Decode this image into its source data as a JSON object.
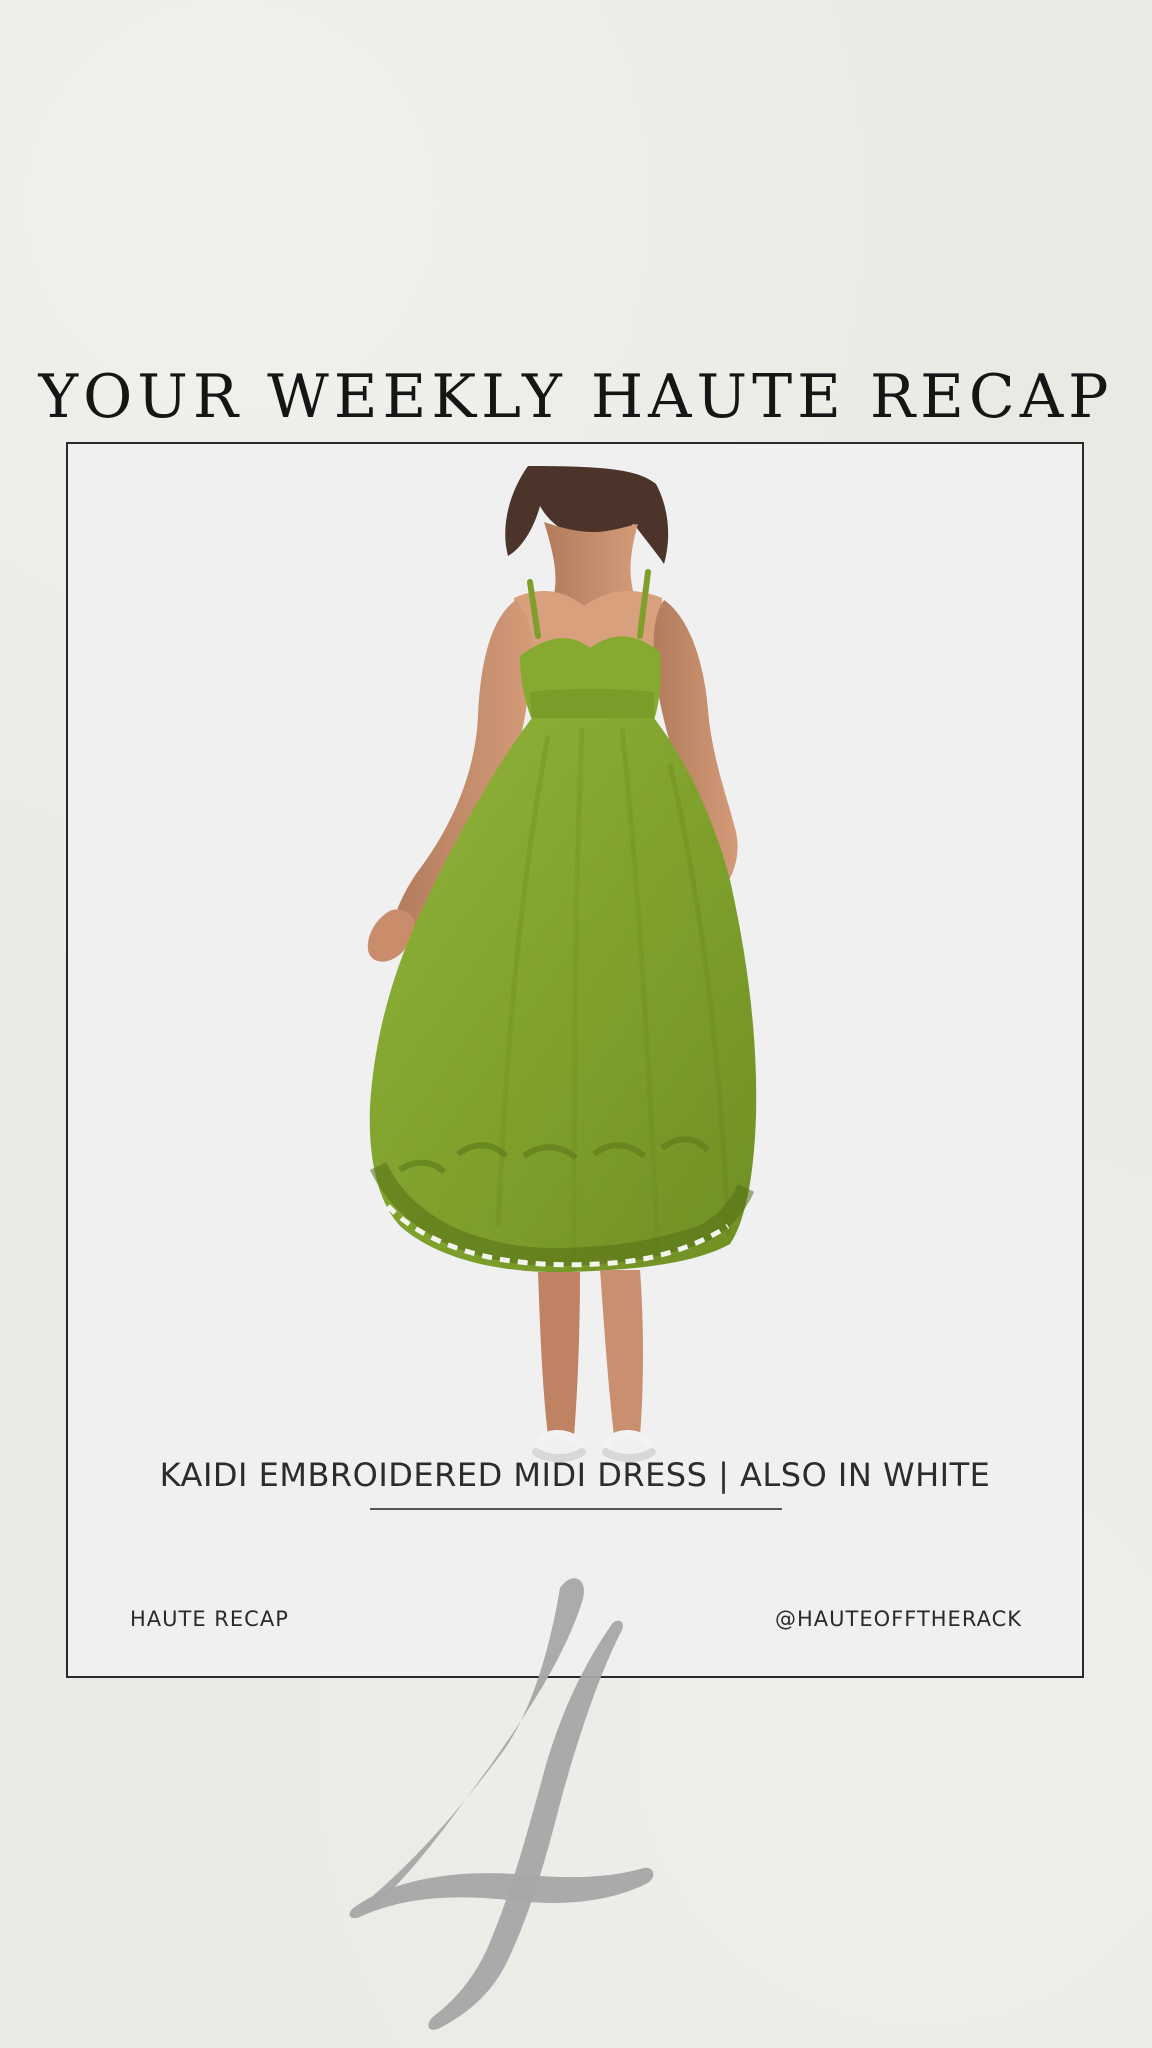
{
  "page": {
    "title": "YOUR WEEKLY HAUTE RECAP"
  },
  "card": {
    "product_caption": "KAIDI EMBROIDERED MIDI DRESS | ALSO IN WHITE",
    "footer_left": "HAUTE RECAP",
    "footer_right": "@HAUTEOFFTHERACK"
  },
  "decor": {
    "number_label": "4"
  },
  "colors": {
    "background": "#ebe9e4",
    "card_background": "#f0f0f0",
    "text": "#151515",
    "dress_green": "#7fa02c",
    "number_gray": "#a7a7a7"
  },
  "icons": {
    "product_image": "green-midi-dress-model"
  }
}
